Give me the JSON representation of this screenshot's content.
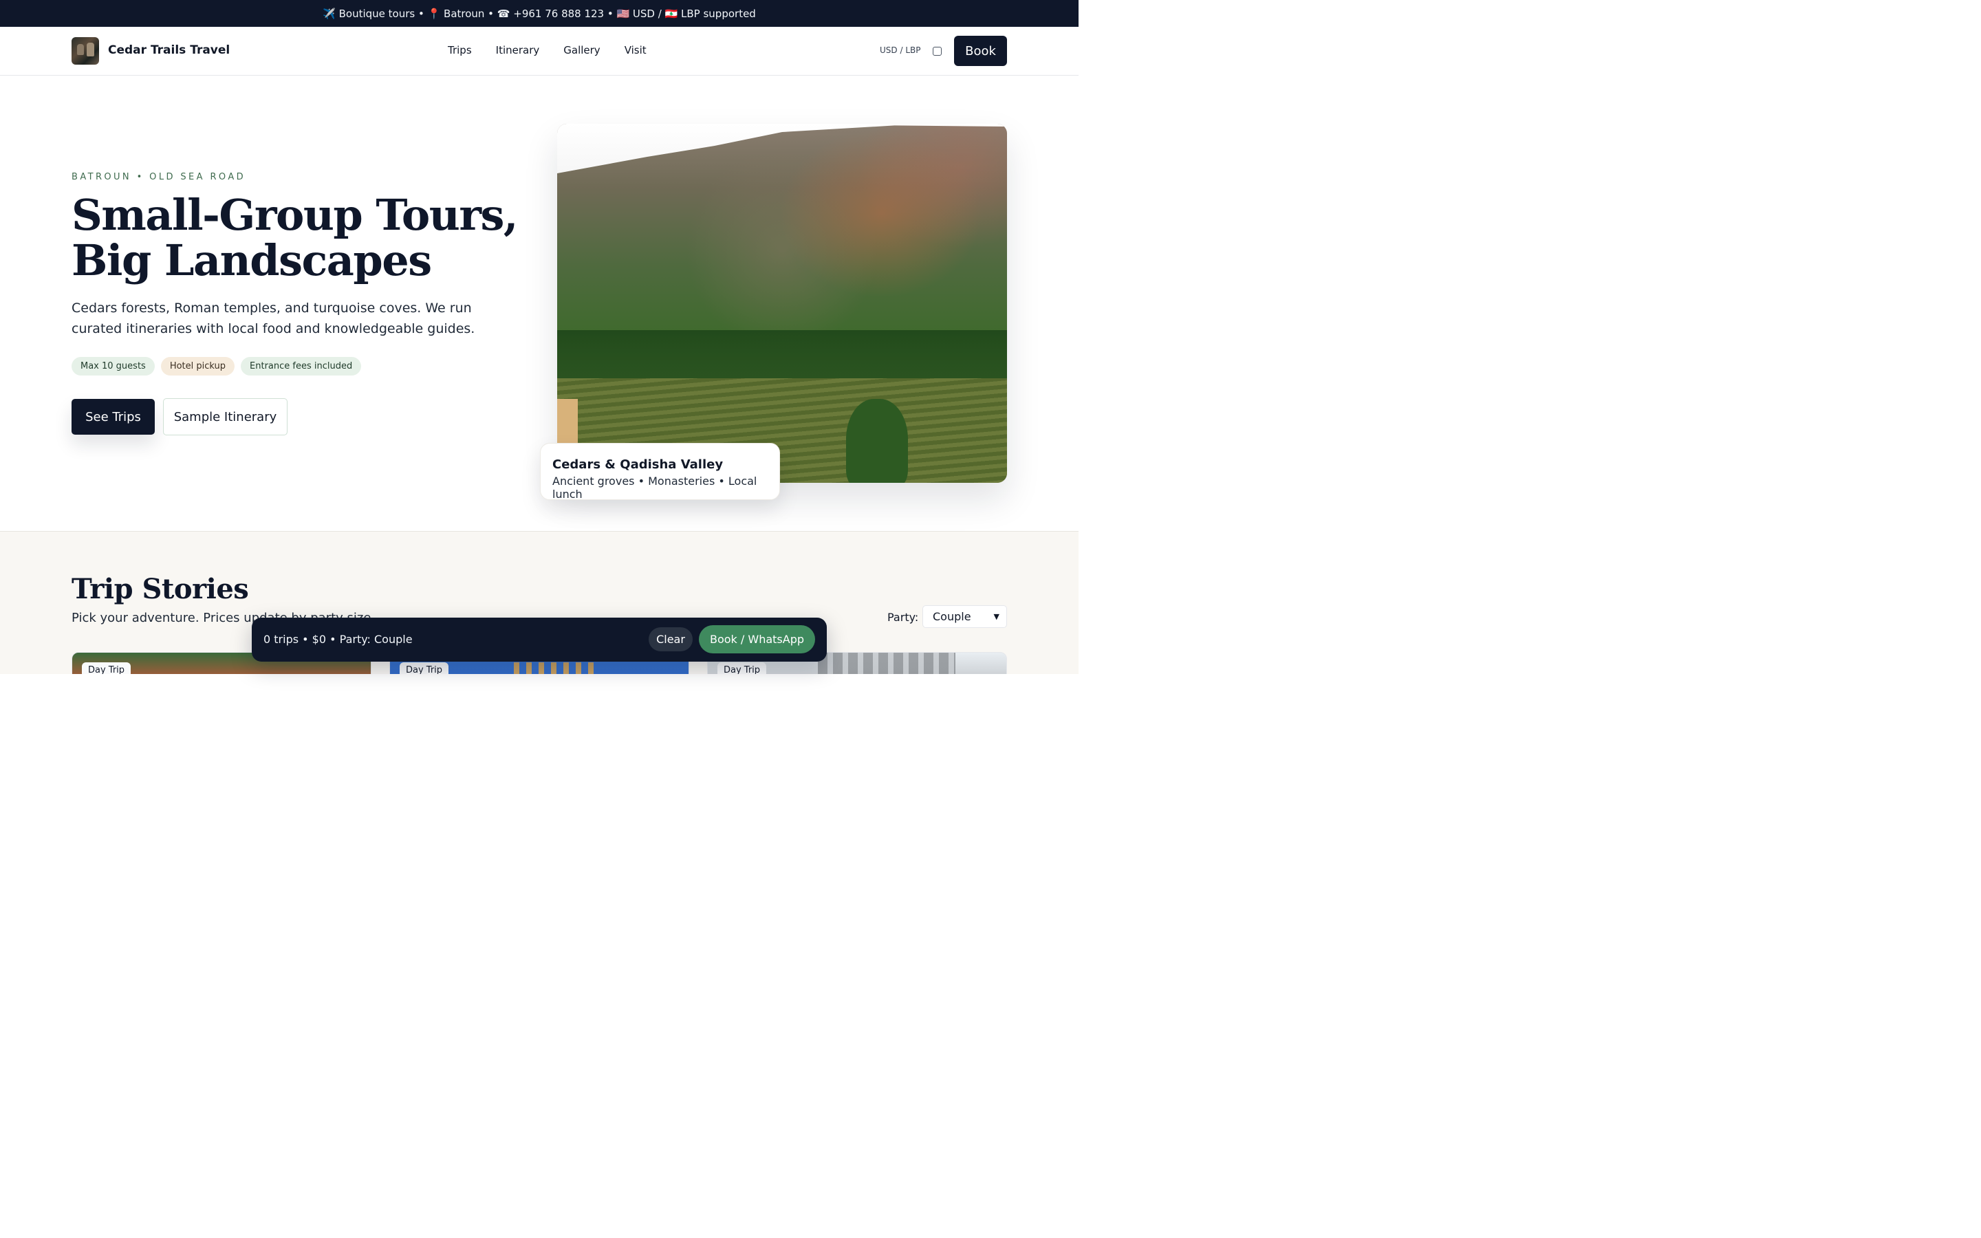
{
  "topbar": {
    "text": "✈️ Boutique tours • 📍 Batroun • ☎ +961 76 888 123 • 🇺🇸 USD / 🇱🇧 LBP supported"
  },
  "nav": {
    "brand": "Cedar Trails Travel",
    "links": [
      "Trips",
      "Itinerary",
      "Gallery",
      "Visit"
    ],
    "currency_label": "USD / LBP",
    "book_label": "Book"
  },
  "hero": {
    "eyebrow": "BATROUN • OLD SEA ROAD",
    "title_line1": "Small-Group Tours,",
    "title_line2": "Big Landscapes",
    "subtitle": "Cedars forests, Roman temples, and turquoise coves. We run curated itineraries with local food and knowledgeable guides.",
    "chips": [
      "Max 10 guests",
      "Hotel pickup",
      "Entrance fees included"
    ],
    "primary_cta": "See Trips",
    "secondary_cta": "Sample Itinerary",
    "caption_title": "Cedars & Qadisha Valley",
    "caption_sub": "Ancient groves • Monasteries • Local lunch"
  },
  "trips": {
    "title": "Trip Stories",
    "subtitle": "Pick your adventure. Prices update by party size.",
    "party_label": "Party:",
    "party_selected": "Couple",
    "cards": [
      {
        "tag": "Day Trip"
      },
      {
        "tag": "Day Trip"
      },
      {
        "tag": "Day Trip"
      }
    ]
  },
  "cart": {
    "summary": "0 trips • $0 • Party: Couple",
    "clear_label": "Clear",
    "book_label": "Book / WhatsApp"
  },
  "colors": {
    "dark": "#0f172a",
    "accent_green": "#3f8a5e",
    "chip_green": "#e6f1e8",
    "chip_sand": "#f6ebdc"
  }
}
